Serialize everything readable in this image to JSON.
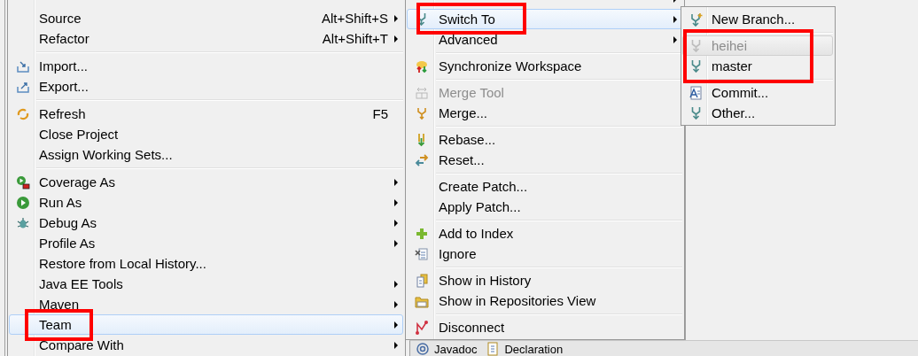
{
  "menus": [
    {
      "items": [
        {
          "kind": "clipped"
        },
        {
          "kind": "item",
          "label": "Source",
          "shortcut": "Alt+Shift+S",
          "submenu": true,
          "selected": false,
          "disabled": false
        },
        {
          "kind": "item",
          "label": "Refactor",
          "shortcut": "Alt+Shift+T",
          "submenu": true,
          "selected": false,
          "disabled": false
        },
        {
          "kind": "separator"
        },
        {
          "kind": "item",
          "label": "Import...",
          "submenu": false,
          "selected": false,
          "disabled": false
        },
        {
          "kind": "item",
          "label": "Export...",
          "submenu": false,
          "selected": false,
          "disabled": false
        },
        {
          "kind": "separator"
        },
        {
          "kind": "item",
          "label": "Refresh",
          "shortcut": "F5",
          "submenu": false,
          "selected": false,
          "disabled": false
        },
        {
          "kind": "item",
          "label": "Close Project",
          "submenu": false,
          "selected": false,
          "disabled": false
        },
        {
          "kind": "item",
          "label": "Assign Working Sets...",
          "submenu": false,
          "selected": false,
          "disabled": false
        },
        {
          "kind": "separator"
        },
        {
          "kind": "item",
          "label": "Coverage As",
          "submenu": true,
          "selected": false,
          "disabled": false
        },
        {
          "kind": "item",
          "label": "Run As",
          "submenu": true,
          "selected": false,
          "disabled": false
        },
        {
          "kind": "item",
          "label": "Debug As",
          "submenu": true,
          "selected": false,
          "disabled": false
        },
        {
          "kind": "item",
          "label": "Profile As",
          "submenu": true,
          "selected": false,
          "disabled": false
        },
        {
          "kind": "item",
          "label": "Restore from Local History...",
          "submenu": false,
          "selected": false,
          "disabled": false
        },
        {
          "kind": "item",
          "label": "Java EE Tools",
          "submenu": true,
          "selected": false,
          "disabled": false
        },
        {
          "kind": "item",
          "label": "Maven",
          "submenu": true,
          "selected": false,
          "disabled": false
        },
        {
          "kind": "item",
          "label": "Team",
          "submenu": true,
          "selected": true,
          "disabled": false
        },
        {
          "kind": "item",
          "label": "Compare With",
          "submenu": true,
          "selected": false,
          "disabled": false
        }
      ]
    },
    {
      "items": [
        {
          "kind": "item",
          "submenu": true,
          "selected": false,
          "disabled": false
        },
        {
          "kind": "item",
          "label": "Switch To",
          "submenu": true,
          "selected": true,
          "disabled": false
        },
        {
          "kind": "item",
          "label": "Advanced",
          "submenu": true,
          "selected": false,
          "disabled": false
        },
        {
          "kind": "separator"
        },
        {
          "kind": "item",
          "label": "Synchronize Workspace",
          "submenu": false,
          "selected": false,
          "disabled": false
        },
        {
          "kind": "separator"
        },
        {
          "kind": "item",
          "label": "Merge Tool",
          "submenu": false,
          "selected": false,
          "disabled": true
        },
        {
          "kind": "item",
          "label": "Merge...",
          "submenu": false,
          "selected": false,
          "disabled": false
        },
        {
          "kind": "separator"
        },
        {
          "kind": "item",
          "label": "Rebase...",
          "submenu": false,
          "selected": false,
          "disabled": false
        },
        {
          "kind": "item",
          "label": "Reset...",
          "submenu": false,
          "selected": false,
          "disabled": false
        },
        {
          "kind": "separator"
        },
        {
          "kind": "item",
          "label": "Create Patch...",
          "submenu": false,
          "selected": false,
          "disabled": false
        },
        {
          "kind": "item",
          "label": "Apply Patch...",
          "submenu": false,
          "selected": false,
          "disabled": false
        },
        {
          "kind": "separator"
        },
        {
          "kind": "item",
          "label": "Add to Index",
          "submenu": false,
          "selected": false,
          "disabled": false
        },
        {
          "kind": "item",
          "label": "Ignore",
          "submenu": false,
          "selected": false,
          "disabled": false
        },
        {
          "kind": "separator"
        },
        {
          "kind": "item",
          "label": "Show in History",
          "submenu": false,
          "selected": false,
          "disabled": false
        },
        {
          "kind": "item",
          "label": "Show in Repositories View",
          "submenu": false,
          "selected": false,
          "disabled": false
        },
        {
          "kind": "separator"
        },
        {
          "kind": "item",
          "label": "Disconnect",
          "submenu": false,
          "selected": false,
          "disabled": false
        }
      ]
    },
    {
      "items": [
        {
          "kind": "item",
          "label": "New Branch...",
          "submenu": false,
          "selected": false,
          "disabled": false
        },
        {
          "kind": "separator"
        },
        {
          "kind": "item",
          "label": "heihei",
          "submenu": false,
          "selected": true,
          "disabled": true
        },
        {
          "kind": "item",
          "label": "master",
          "submenu": false,
          "selected": false,
          "disabled": false
        },
        {
          "kind": "separator"
        },
        {
          "kind": "item",
          "label": "Commit...",
          "submenu": false,
          "selected": false,
          "disabled": false
        },
        {
          "kind": "item",
          "label": "Other...",
          "submenu": false,
          "selected": false,
          "disabled": false
        }
      ]
    }
  ],
  "bottom_tabs": [
    {
      "label": "Javadoc"
    },
    {
      "label": "Declaration"
    }
  ]
}
